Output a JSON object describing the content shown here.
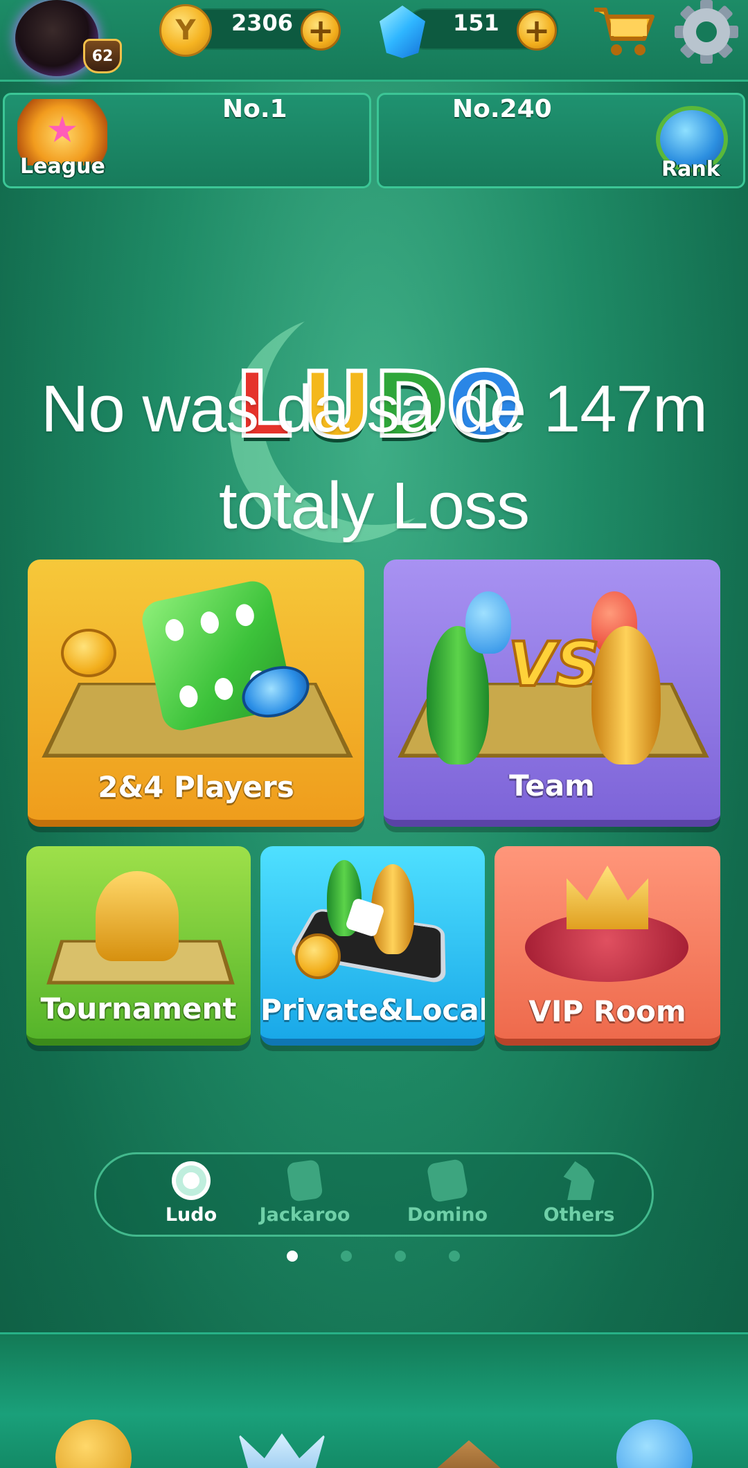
{
  "header": {
    "player_level": "62",
    "coins": "2306",
    "gems": "151",
    "coin_icon": "coin-icon",
    "gem_icon": "gem-icon",
    "plus_glyph": "+",
    "coin_glyph": "Y"
  },
  "rankings": {
    "league_label": "League",
    "league_position": "No.1",
    "rank_position": "No.240",
    "rank_label": "Rank"
  },
  "logo": {
    "letters": [
      "L",
      "U",
      "D",
      "O"
    ],
    "colors": [
      "#e5332b",
      "#f4b81c",
      "#2fa63a",
      "#2a86e6"
    ]
  },
  "caption": {
    "line1": "No was da sa de 147m",
    "line2": "totaly Loss"
  },
  "game_modes": {
    "two_four_players": "2&4 Players",
    "team": "Team",
    "vs_text": "VS",
    "tournament": "Tournament",
    "private_local": "Private&Local",
    "vip_room": "VIP Room"
  },
  "mode_tabs": [
    {
      "label": "Ludo",
      "active": true
    },
    {
      "label": "Jackaroo",
      "active": false
    },
    {
      "label": "Domino",
      "active": false
    },
    {
      "label": "Others",
      "active": false
    }
  ],
  "page_dots": {
    "count": 4,
    "active_index": 0
  },
  "colors": {
    "background": "#1f8b66",
    "active_tab": "#ffffff",
    "inactive_tab": "#6fd0a8",
    "accent_gold": "#f5b321"
  }
}
